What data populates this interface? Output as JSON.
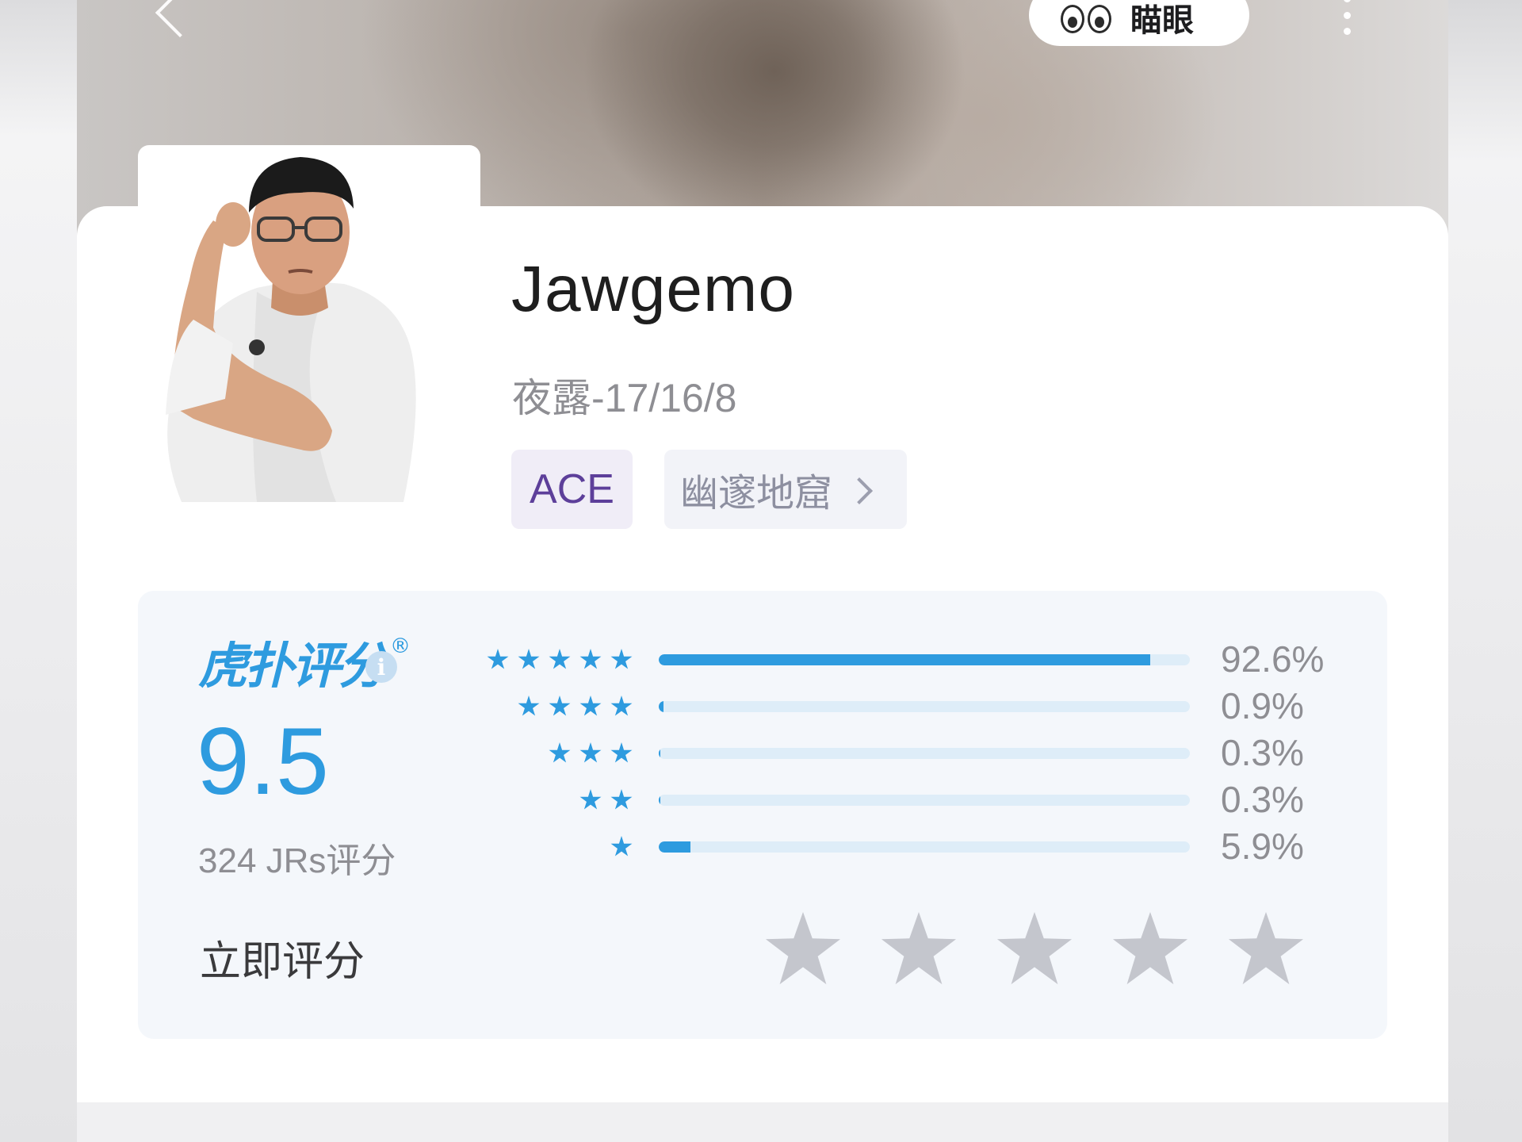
{
  "header": {
    "glance_label": "瞄眼"
  },
  "player": {
    "name": "Jawgemo",
    "subtitle": "夜露-17/16/8",
    "tag_primary": "ACE",
    "tag_location": "幽邃地窟"
  },
  "rating": {
    "brand": "虎扑评分",
    "brand_reg": "®",
    "score": "9.5",
    "count_text": "324 JRs评分",
    "rate_now_label": "立即评分",
    "distribution": [
      {
        "stars": 5,
        "percent_text": "92.6%",
        "percent": 92.6
      },
      {
        "stars": 4,
        "percent_text": "0.9%",
        "percent": 0.9
      },
      {
        "stars": 3,
        "percent_text": "0.3%",
        "percent": 0.3
      },
      {
        "stars": 2,
        "percent_text": "0.3%",
        "percent": 0.3
      },
      {
        "stars": 1,
        "percent_text": "5.9%",
        "percent": 5.9
      }
    ]
  },
  "colors": {
    "accent": "#2e9bdf",
    "ace_text": "#5d3f9a",
    "star_inactive": "#c4c6cd"
  }
}
